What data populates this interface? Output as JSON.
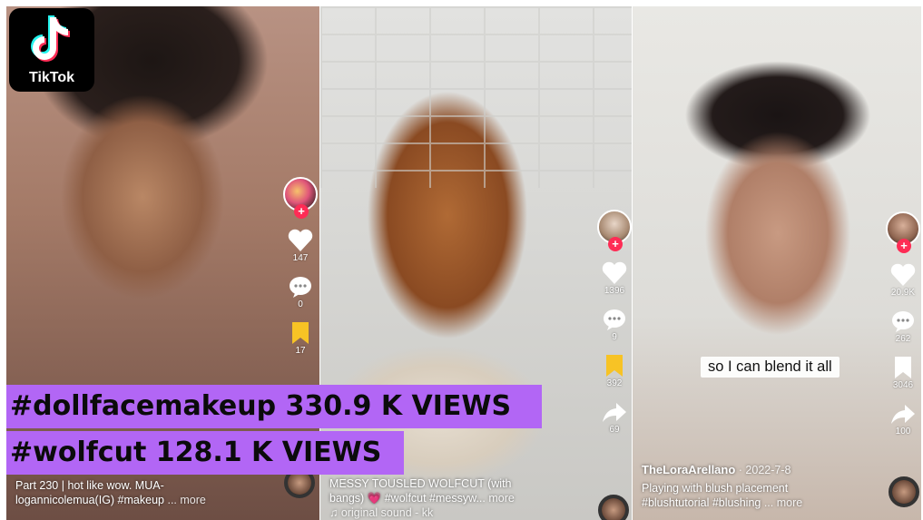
{
  "brand": {
    "logo_text": "TikTok"
  },
  "videos": [
    {
      "likes": "147",
      "comments": "0",
      "saves": "17",
      "caption_line1": "Part 230 | hot like wow. MUA-",
      "caption_line2": "logannicolemua(IG) #makeup",
      "more": "... more"
    },
    {
      "likes": "1396",
      "comments": "9",
      "saves": "392",
      "shares": "69",
      "caption_line1": "MESSY TOUSLED WOLFCUT (with",
      "caption_line2": "bangs) 💗 #wolfcut #messyw...",
      "more": "more",
      "sound": "♫ original sound - kk"
    },
    {
      "likes": "20.9K",
      "comments": "262",
      "saves": "3046",
      "shares": "100",
      "subtitle": "so I can blend it all",
      "username": "TheLoraArellano",
      "date": "· 2022-7-8",
      "caption_line1": "Playing with blush placement",
      "caption_line2": "#blushtutorial #blushing",
      "more": "... more"
    }
  ],
  "banners": [
    {
      "text": "#dollfacemakeup 330.9 K VIEWS"
    },
    {
      "text": "#wolfcut 128.1 K VIEWS"
    }
  ],
  "colors": {
    "banner_bg": "#b266f5",
    "follow_plus": "#fe2c55",
    "save_yellow": "#f7c325"
  }
}
